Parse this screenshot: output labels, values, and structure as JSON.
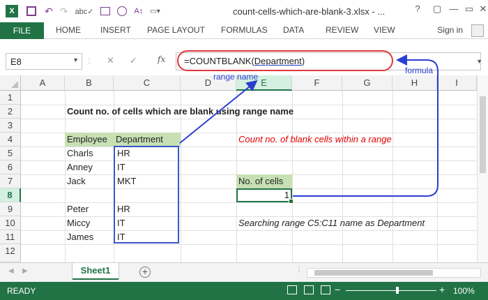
{
  "window": {
    "title": "count-cells-which-are-blank-3.xlsx - ...",
    "help_icon": "?",
    "minimize_icon": "—",
    "restore_icon": "▭",
    "close_icon": "✕"
  },
  "ribbon": {
    "tabs": [
      "FILE",
      "HOME",
      "INSERT",
      "PAGE LAYOUT",
      "FORMULAS",
      "DATA",
      "REVIEW",
      "VIEW"
    ],
    "signin": "Sign in"
  },
  "formula_bar": {
    "name_box": "E8",
    "fx": "fx",
    "formula_prefix": "=COUNTBLANK(",
    "formula_range": "Department",
    "formula_suffix": ")"
  },
  "columns": [
    "A",
    "B",
    "C",
    "D",
    "E",
    "F",
    "G",
    "H",
    "I"
  ],
  "rows": [
    "1",
    "2",
    "3",
    "4",
    "5",
    "6",
    "7",
    "8",
    "9",
    "10",
    "11",
    "12"
  ],
  "cells": {
    "b2": "Count no. of cells which are blank using range name",
    "b4": "Employee",
    "c4": "Department",
    "b5": "Charls",
    "c5": "HR",
    "b6": "Anney",
    "c6": "IT",
    "b7": "Jack",
    "c7": "MKT",
    "b9": "Peter",
    "c9": "HR",
    "b10": "Miccy",
    "c10": "IT",
    "b11": "James",
    "c11": "IT",
    "e4": "Count no. of blank cells within a range",
    "e7": "No. of cells",
    "e8": "1",
    "e10": "Searching range C5:C11 name as Department"
  },
  "annotations": {
    "range_name": "range name",
    "formula": "formula"
  },
  "sheet_tabs": {
    "active": "Sheet1",
    "add": "+"
  },
  "status": {
    "ready": "READY",
    "zoom": "100%",
    "zoom_minus": "−",
    "zoom_plus": "+"
  },
  "colors": {
    "accent": "#217346",
    "header_fill": "#c6e0b4",
    "annotation": "#2b3fcf",
    "oval": "#e0373b"
  }
}
